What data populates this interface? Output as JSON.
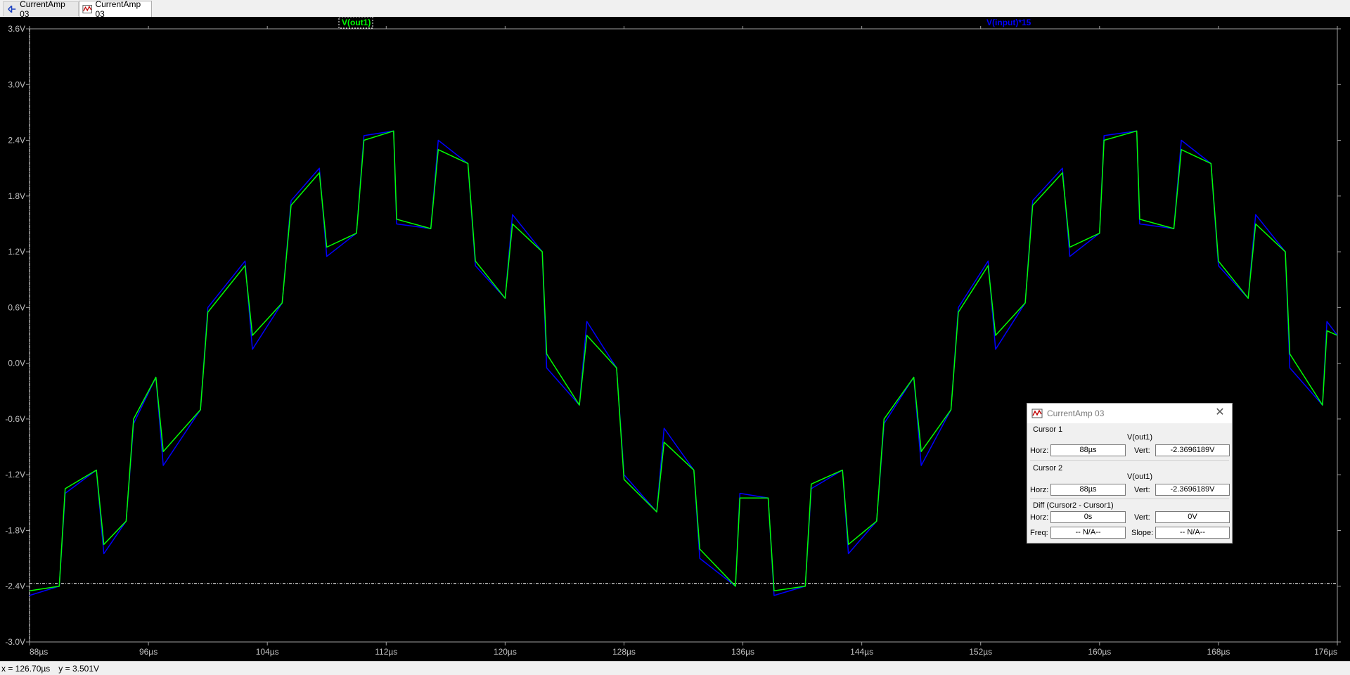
{
  "tabs": [
    {
      "label": "CurrentAmp 03",
      "icon": "schematic-icon"
    },
    {
      "label": "CurrentAmp 03",
      "icon": "waveform-icon"
    }
  ],
  "plot": {
    "background": "#000000",
    "trace_labels": [
      {
        "label": "V(out1)",
        "color": "#00ff00"
      },
      {
        "label": "V(input)*15",
        "color": "#0000ff"
      }
    ]
  },
  "chart_data": {
    "type": "line",
    "x": [
      88,
      90,
      90.4,
      92.5,
      93,
      94.5,
      95,
      96.5,
      97,
      99.5,
      100,
      102.5,
      103,
      105,
      105.6,
      107.5,
      108,
      110,
      110.5,
      112.5,
      112.7,
      115,
      115.5,
      117.5,
      118,
      120,
      120.5,
      122.5,
      122.8,
      125,
      125.5,
      127.5,
      128,
      130.2,
      130.7,
      132.7,
      133.1,
      135.5,
      135.8,
      137.7,
      138.1,
      140.2,
      140.6,
      142.7,
      143.1,
      145,
      145.5,
      147.5,
      148,
      150,
      150.5,
      152.5,
      153,
      155,
      155.5,
      157.5,
      158,
      160,
      160.3,
      162.5,
      162.7,
      165,
      165.5,
      167.5,
      168,
      170,
      170.5,
      172.5,
      172.8,
      175,
      175.3,
      176
    ],
    "series": [
      {
        "name": "V(out1)",
        "color": "#00ff00",
        "values": [
          -2.45,
          -2.4,
          -1.35,
          -1.15,
          -1.95,
          -1.7,
          -0.6,
          -0.15,
          -0.95,
          -0.5,
          0.55,
          1.05,
          0.3,
          0.65,
          1.7,
          2.05,
          1.25,
          1.4,
          2.4,
          2.5,
          1.55,
          1.45,
          2.3,
          2.15,
          1.1,
          0.7,
          1.5,
          1.2,
          0.1,
          -0.45,
          0.3,
          -0.05,
          -1.25,
          -1.6,
          -0.85,
          -1.15,
          -2.0,
          -2.4,
          -1.45,
          -1.45,
          -2.45,
          -2.4,
          -1.3,
          -1.15,
          -1.95,
          -1.7,
          -0.6,
          -0.15,
          -0.95,
          -0.5,
          0.55,
          1.05,
          0.3,
          0.65,
          1.7,
          2.05,
          1.25,
          1.4,
          2.4,
          2.5,
          1.55,
          1.45,
          2.3,
          2.15,
          1.1,
          0.7,
          1.5,
          1.2,
          0.1,
          -0.45,
          0.35,
          0.3
        ]
      },
      {
        "name": "V(input)*15",
        "color": "#0000ff",
        "values": [
          -2.5,
          -2.4,
          -1.4,
          -1.15,
          -2.05,
          -1.7,
          -0.65,
          -0.15,
          -1.1,
          -0.5,
          0.6,
          1.1,
          0.15,
          0.65,
          1.75,
          2.1,
          1.15,
          1.4,
          2.45,
          2.5,
          1.5,
          1.45,
          2.4,
          2.15,
          1.05,
          0.7,
          1.6,
          1.2,
          -0.05,
          -0.45,
          0.45,
          -0.05,
          -1.2,
          -1.6,
          -0.7,
          -1.15,
          -2.1,
          -2.4,
          -1.4,
          -1.45,
          -2.5,
          -2.4,
          -1.35,
          -1.15,
          -2.05,
          -1.7,
          -0.65,
          -0.15,
          -1.1,
          -0.5,
          0.6,
          1.1,
          0.15,
          0.65,
          1.75,
          2.1,
          1.15,
          1.4,
          2.45,
          2.5,
          1.5,
          1.45,
          2.4,
          2.15,
          1.05,
          0.7,
          1.6,
          1.2,
          -0.05,
          -0.45,
          0.45,
          0.3
        ]
      }
    ],
    "xlim": [
      88,
      176
    ],
    "ylim": [
      -3.0,
      3.6
    ],
    "x_ticks": [
      "88µs",
      "96µs",
      "104µs",
      "112µs",
      "120µs",
      "128µs",
      "136µs",
      "144µs",
      "152µs",
      "160µs",
      "168µs",
      "176µs"
    ],
    "x_tick_values": [
      88,
      96,
      104,
      112,
      120,
      128,
      136,
      144,
      152,
      160,
      168,
      176
    ],
    "y_ticks": [
      "3.6V",
      "3.0V",
      "2.4V",
      "1.8V",
      "1.2V",
      "0.6V",
      "0.0V",
      "-0.6V",
      "-1.2V",
      "-1.8V",
      "-2.4V",
      "-3.0V"
    ],
    "y_tick_values": [
      3.6,
      3.0,
      2.4,
      1.8,
      1.2,
      0.6,
      0.0,
      -0.6,
      -1.2,
      -1.8,
      -2.4,
      -3.0
    ],
    "cursor_level": -2.3696189,
    "cursor_x": 88,
    "grid": false,
    "axis_color": "#a0a0a0",
    "tick_label_color": "#c0c0c0"
  },
  "cursor_window": {
    "title": "CurrentAmp 03",
    "cursor1": {
      "heading": "Cursor 1",
      "trace": "V(out1)",
      "horz_label": "Horz:",
      "horz": "88µs",
      "vert_label": "Vert:",
      "vert": "-2.3696189V"
    },
    "cursor2": {
      "heading": "Cursor 2",
      "trace": "V(out1)",
      "horz_label": "Horz:",
      "horz": "88µs",
      "vert_label": "Vert:",
      "vert": "-2.3696189V"
    },
    "diff": {
      "heading": "Diff (Cursor2 - Cursor1)",
      "horz_label": "Horz:",
      "horz": "0s",
      "vert_label": "Vert:",
      "vert": "0V",
      "freq_label": "Freq:",
      "freq": "-- N/A--",
      "slope_label": "Slope:",
      "slope": "-- N/A--"
    }
  },
  "status": {
    "x": "x = 126.70µs",
    "y": "y = 3.501V"
  }
}
